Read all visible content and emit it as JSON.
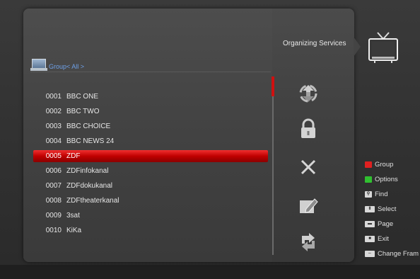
{
  "header": {
    "title": "Organizing Services"
  },
  "group": {
    "label": "Group< All >"
  },
  "channels": [
    {
      "num": "0001",
      "name": "BBC ONE"
    },
    {
      "num": "0002",
      "name": "BBC TWO"
    },
    {
      "num": "0003",
      "name": "BBC CHOICE"
    },
    {
      "num": "0004",
      "name": "BBC NEWS 24"
    },
    {
      "num": "0005",
      "name": "ZDF"
    },
    {
      "num": "0006",
      "name": "ZDFinfokanal"
    },
    {
      "num": "0007",
      "name": "ZDFdokukanal"
    },
    {
      "num": "0008",
      "name": "ZDFtheaterkanal"
    },
    {
      "num": "0009",
      "name": "3sat"
    },
    {
      "num": "0010",
      "name": "KiKa"
    }
  ],
  "selected_channel_index": 4,
  "actions": [
    {
      "icon": "move-icon"
    },
    {
      "icon": "lock-icon"
    },
    {
      "icon": "delete-icon"
    },
    {
      "icon": "rename-icon"
    },
    {
      "icon": "swap-icon"
    }
  ],
  "legend": [
    {
      "label": "Group",
      "swatch": "#e02020"
    },
    {
      "label": "Options",
      "swatch": "#30c030"
    },
    {
      "label": "Find",
      "key": "find-key-icon"
    },
    {
      "label": "Select",
      "key": "up-down-key-icon"
    },
    {
      "label": "Page",
      "key": "page-key-icon"
    },
    {
      "label": "Exit",
      "key": "exit-key-icon"
    },
    {
      "label": "Change Fram",
      "key": "left-right-key-icon"
    }
  ],
  "colors": {
    "highlight": "#d01010",
    "group_text": "#6ea0e8"
  }
}
